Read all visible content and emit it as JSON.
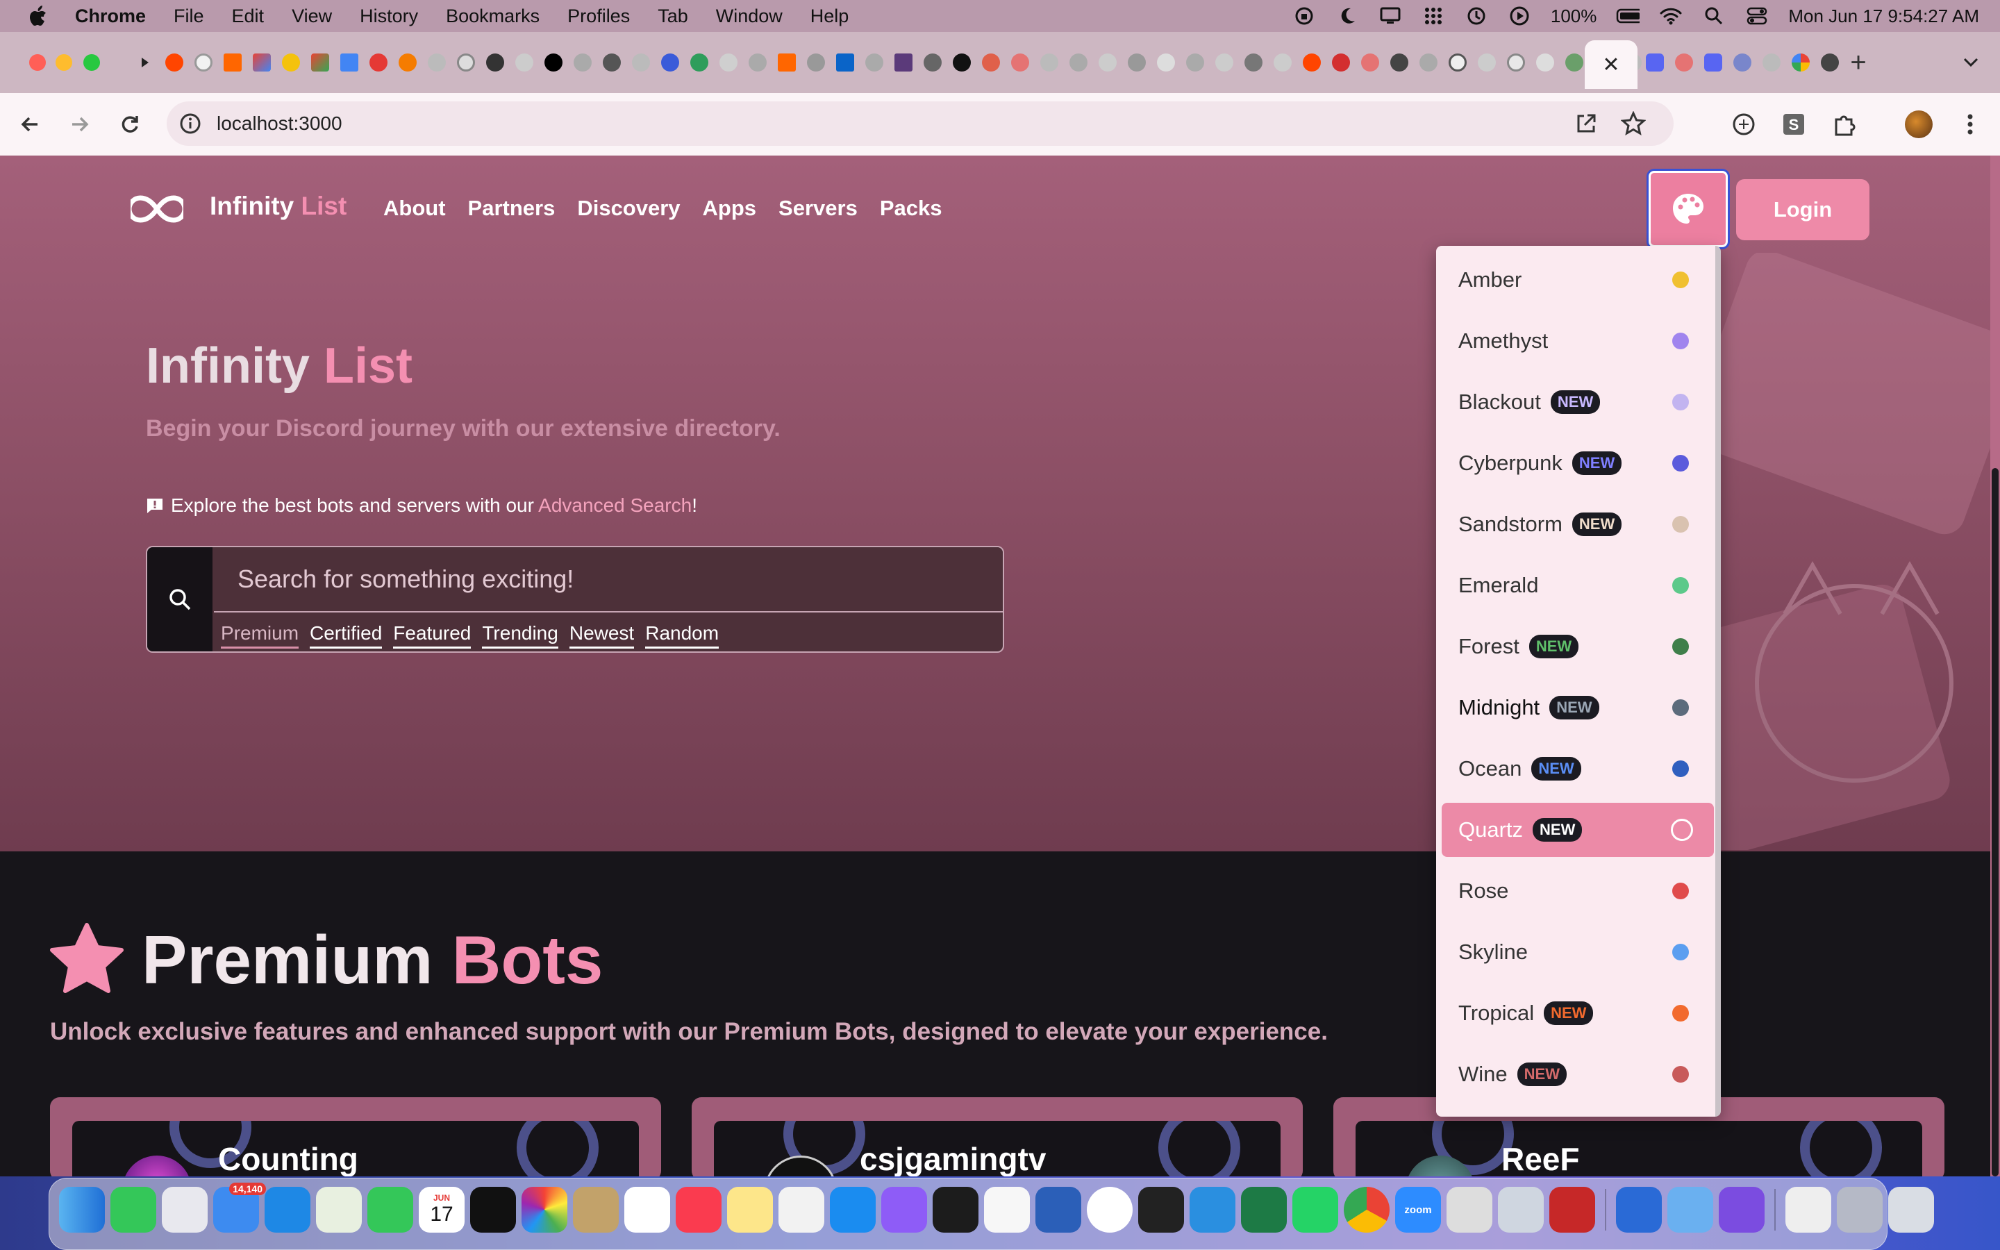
{
  "menubar": {
    "app": "Chrome",
    "items": [
      "File",
      "Edit",
      "View",
      "History",
      "Bookmarks",
      "Profiles",
      "Tab",
      "Window",
      "Help"
    ],
    "battery": "100%",
    "datetime": "Mon Jun 17  9:54:27 AM"
  },
  "browser": {
    "url": "localhost:3000",
    "active_tab_close": "✕",
    "new_tab": "+"
  },
  "nav": {
    "brand_main": "Infinity",
    "brand_accent": "List",
    "links": [
      "About",
      "Partners",
      "Discovery",
      "Apps",
      "Servers",
      "Packs"
    ],
    "login": "Login"
  },
  "hero": {
    "title_main": "Infinity",
    "title_accent": "List",
    "subtitle": "Begin your Discord journey with our extensive directory.",
    "hint_before": "Explore the best bots and servers with our",
    "hint_link": "Advanced Search",
    "hint_after": "!"
  },
  "search": {
    "placeholder": "Search for something exciting!",
    "filters": [
      "Premium",
      "Certified",
      "Featured",
      "Trending",
      "Newest",
      "Random"
    ]
  },
  "premium": {
    "title_main": "Premium",
    "title_accent": "Bots",
    "subtitle": "Unlock exclusive features and enhanced support with our Premium Bots, designed to elevate your experience.",
    "cards": [
      "Counting",
      "csjgamingtv",
      "ReeF"
    ]
  },
  "theme_menu": {
    "new_label": "NEW",
    "options": [
      {
        "name": "Amber",
        "is_new": false,
        "color": "#f0c030",
        "new_text_color": ""
      },
      {
        "name": "Amethyst",
        "is_new": false,
        "color": "#a084ee",
        "new_text_color": ""
      },
      {
        "name": "Blackout",
        "is_new": true,
        "color": "#c2b4f0",
        "new_text_color": "#c8b8ff"
      },
      {
        "name": "Cyberpunk",
        "is_new": true,
        "color": "#5b5bdc",
        "new_text_color": "#7f7fff"
      },
      {
        "name": "Sandstorm",
        "is_new": true,
        "color": "#d9c2b0",
        "new_text_color": "#f0dccb"
      },
      {
        "name": "Emerald",
        "is_new": false,
        "color": "#5cc98a",
        "new_text_color": ""
      },
      {
        "name": "Forest",
        "is_new": true,
        "color": "#3f7f4a",
        "new_text_color": "#5fbf6a"
      },
      {
        "name": "Midnight",
        "is_new": true,
        "color": "#5c6b7c",
        "new_text_color": "#9aa6b4"
      },
      {
        "name": "Ocean",
        "is_new": true,
        "color": "#2f5fbf",
        "new_text_color": "#5a8ef5"
      },
      {
        "name": "Quartz",
        "is_new": true,
        "color": "#ffffff",
        "new_text_color": "#ffffff"
      },
      {
        "name": "Rose",
        "is_new": false,
        "color": "#e04b4b",
        "new_text_color": ""
      },
      {
        "name": "Skyline",
        "is_new": false,
        "color": "#5b9ef0",
        "new_text_color": ""
      },
      {
        "name": "Tropical",
        "is_new": true,
        "color": "#f26a2e",
        "new_text_color": "#f26a2e"
      },
      {
        "name": "Wine",
        "is_new": true,
        "color": "#c85a5a",
        "new_text_color": "#d46a6a"
      }
    ],
    "selected": "Quartz",
    "hovered": "Midnight"
  },
  "dock": {
    "mail_badge": "14,140",
    "calendar_month": "JUN",
    "calendar_day": "17",
    "zoom_label": "zoom"
  },
  "colors": {
    "accent_pink": "#f48fb1",
    "hero_bg": "#8d5066",
    "dark_bg": "#17151a"
  }
}
